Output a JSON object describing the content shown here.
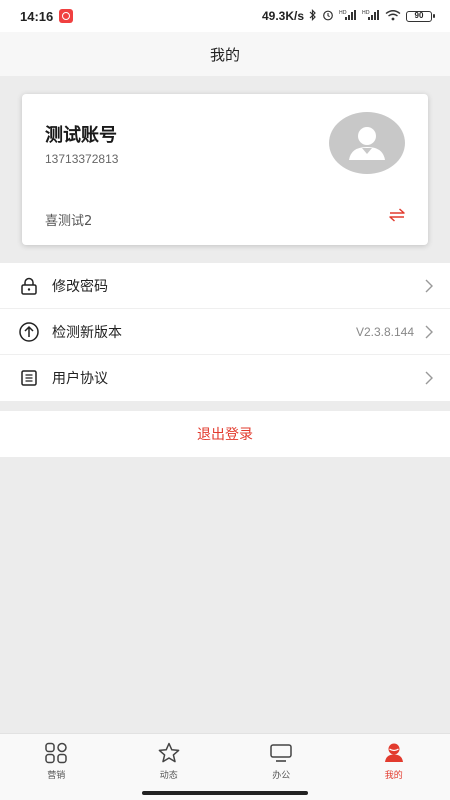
{
  "status_bar": {
    "time": "14:16",
    "net_speed": "49.3K/s",
    "battery": "90"
  },
  "header": {
    "title": "我的"
  },
  "profile": {
    "account_name": "测试账号",
    "phone": "13713372813",
    "org_name": "喜测试2",
    "switch_icon": "swap-arrows-icon",
    "avatar_icon": "user-avatar-icon"
  },
  "menu": {
    "items": [
      {
        "icon": "lock-icon",
        "label": "修改密码",
        "value": ""
      },
      {
        "icon": "upload-circle-icon",
        "label": "检测新版本",
        "value": "V2.3.8.144"
      },
      {
        "icon": "document-list-icon",
        "label": "用户协议",
        "value": ""
      }
    ]
  },
  "logout": {
    "label": "退出登录"
  },
  "bottom_nav": {
    "items": [
      {
        "icon": "grid-icon",
        "label": "营销"
      },
      {
        "icon": "star-icon",
        "label": "动态"
      },
      {
        "icon": "monitor-icon",
        "label": "办公"
      },
      {
        "icon": "user-icon",
        "label": "我的",
        "active": true
      }
    ]
  },
  "colors": {
    "accent": "#e23b2e",
    "background": "#ececec",
    "card": "#ffffff"
  }
}
